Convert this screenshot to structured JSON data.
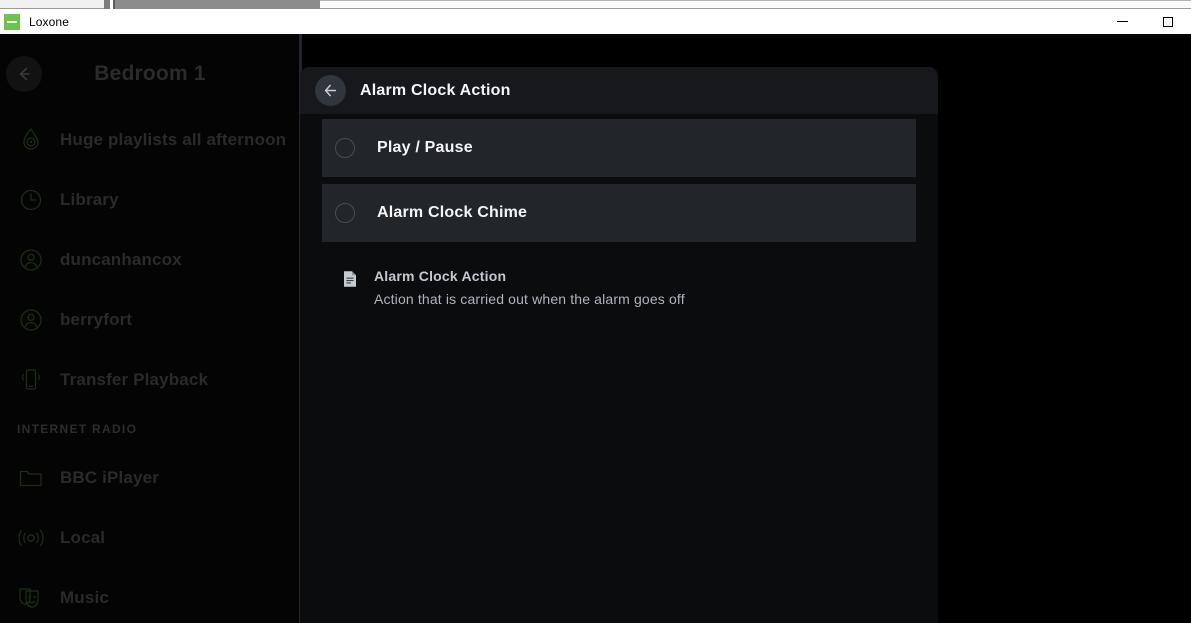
{
  "window": {
    "app_name": "Loxone",
    "app_icon": "loxone-logo-icon",
    "minimize_label": "",
    "maximize_label": ""
  },
  "sidebar": {
    "back_icon": "arrow-left-icon",
    "title": "Bedroom 1",
    "items": [
      {
        "label": "Huge playlists all afternoon",
        "icon": "flame-playlist-icon"
      },
      {
        "label": "Library",
        "icon": "clock-icon"
      },
      {
        "label": "duncanhancox",
        "icon": "user-icon"
      },
      {
        "label": "berryfort",
        "icon": "user-icon"
      },
      {
        "label": "Transfer Playback",
        "icon": "phone-transfer-icon"
      }
    ],
    "section_label": "INTERNET RADIO",
    "radio_items": [
      {
        "label": "BBC iPlayer",
        "icon": "folder-icon"
      },
      {
        "label": "Local",
        "icon": "broadcast-icon"
      },
      {
        "label": "Music",
        "icon": "theater-masks-icon"
      }
    ]
  },
  "modal": {
    "back_icon": "arrow-left-icon",
    "title": "Alarm Clock Action",
    "options": [
      {
        "label": "Play / Pause",
        "selected": false,
        "icon": "radio-button-icon"
      },
      {
        "label": "Alarm Clock Chime",
        "selected": false,
        "icon": "radio-button-icon"
      }
    ],
    "info": {
      "icon": "document-icon",
      "title": "Alarm Clock Action",
      "description": "Action that is carried out when the alarm goes off"
    }
  },
  "colors": {
    "modal_bg": "#0b0c0e",
    "modal_header_bg": "#16181c",
    "option_row_bg": "#22252a",
    "sidebar_bg": "#040404",
    "accent_green": "#6fc24f",
    "text_primary": "#f3f5f7",
    "text_muted": "#aeb4bc",
    "sidebar_text": "#2a2a2a"
  }
}
